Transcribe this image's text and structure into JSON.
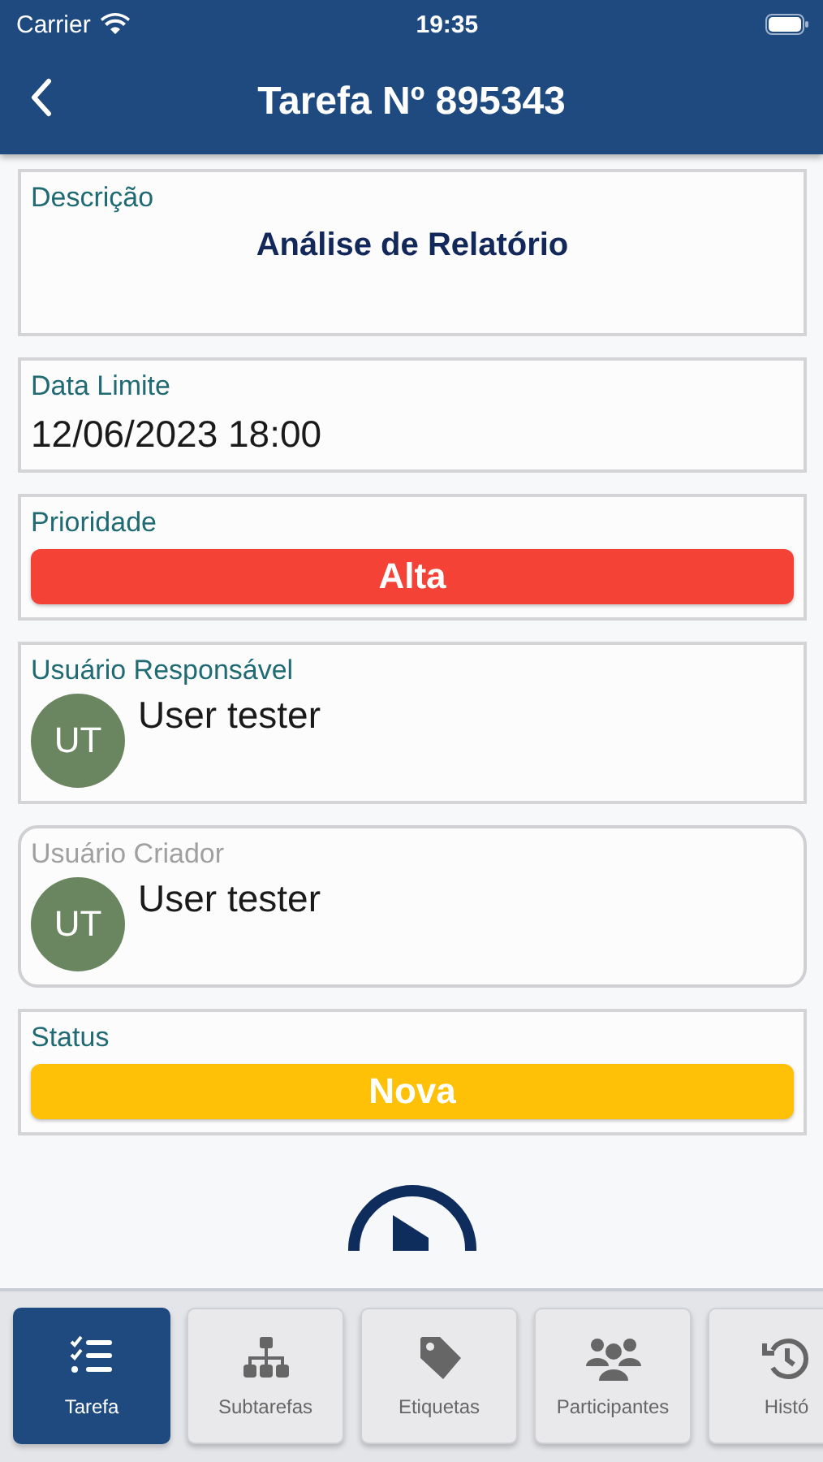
{
  "status_bar": {
    "carrier": "Carrier",
    "time": "19:35"
  },
  "header": {
    "title": "Tarefa Nº 895343"
  },
  "fields": [
    {
      "kind": "title",
      "label": "Descrição",
      "value": "Análise de Relatório",
      "disabled": false
    },
    {
      "kind": "value",
      "label": "Data Limite",
      "value": "12/06/2023 18:00",
      "disabled": false
    },
    {
      "kind": "badge",
      "label": "Prioridade",
      "value": "Alta",
      "color": "#f44336",
      "disabled": false
    },
    {
      "kind": "user",
      "label": "Usuário Responsável",
      "initials": "UT",
      "value": "User tester",
      "disabled": false
    },
    {
      "kind": "user",
      "label": "Usuário Criador",
      "initials": "UT",
      "value": "User tester",
      "disabled": true
    },
    {
      "kind": "badge",
      "label": "Status",
      "value": "Nova",
      "color": "#ffc107",
      "disabled": false
    }
  ],
  "tabs": [
    {
      "kind": "tasks",
      "label": "Tarefa",
      "selected": true
    },
    {
      "kind": "subtasks",
      "label": "Subtarefas",
      "selected": false
    },
    {
      "kind": "tags",
      "label": "Etiquetas",
      "selected": false
    },
    {
      "kind": "people",
      "label": "Participantes",
      "selected": false
    },
    {
      "kind": "history",
      "label": "Histó",
      "selected": false
    }
  ]
}
